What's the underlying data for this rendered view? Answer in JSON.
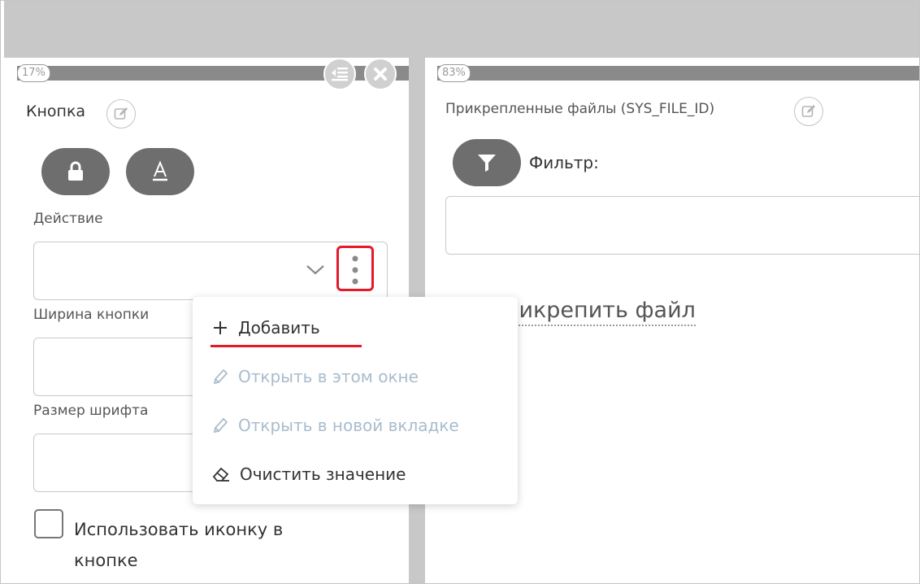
{
  "left_panel": {
    "percent": "17%",
    "title": "Кнопка",
    "action_label": "Действие",
    "action_value": "",
    "width_label": "Ширина кнопки",
    "width_value": "",
    "font_size_label": "Размер шрифта",
    "font_size_value": "",
    "use_icon_label_line1": "Использовать иконку в",
    "use_icon_label_line2": "кнопке",
    "use_icon_checked": false
  },
  "right_panel": {
    "percent": "83%",
    "title": "Прикрепленные файлы (SYS_FILE_ID)",
    "filter_label": "Фильтр:",
    "filter_value": "",
    "attach_link": "Прикрепить файл"
  },
  "context_menu": {
    "items": [
      {
        "label": "Добавить",
        "icon": "plus-icon",
        "enabled": true
      },
      {
        "label": "Открыть в этом окне",
        "icon": "pencil-icon",
        "enabled": false
      },
      {
        "label": "Открыть в новой вкладке",
        "icon": "pencil-icon",
        "enabled": false
      },
      {
        "label": "Очистить значение",
        "icon": "eraser-icon",
        "enabled": true
      }
    ]
  },
  "colors": {
    "highlight_red": "#e21b2a",
    "disabled_text": "#a9bccd",
    "bar_gray": "#8a8a8a",
    "pill_gray": "#6e6e6e"
  }
}
